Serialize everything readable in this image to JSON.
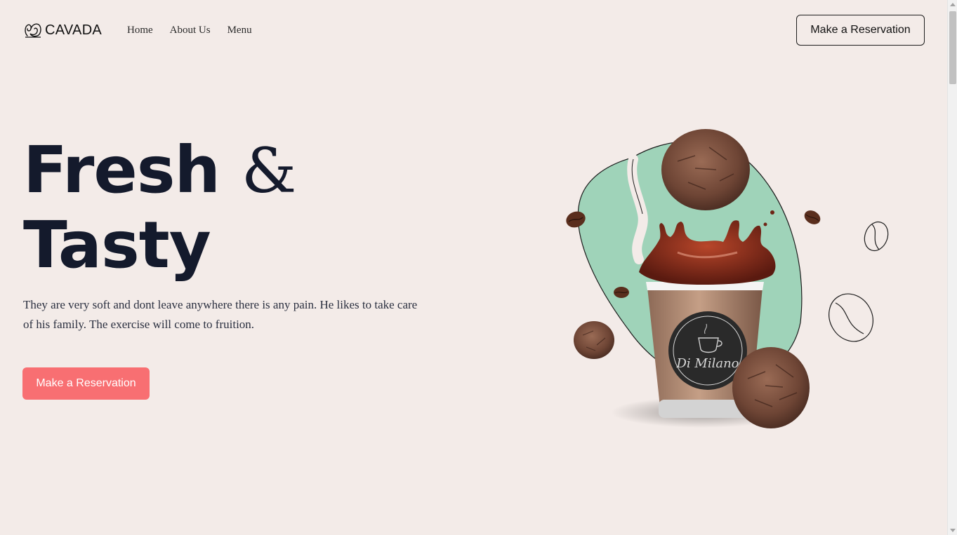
{
  "brand": {
    "name": "CAVADA"
  },
  "nav": {
    "links": [
      "Home",
      "About Us",
      "Menu"
    ],
    "cta_label": "Make a Reservation"
  },
  "hero": {
    "title_line1_word": "Fresh",
    "title_line1_amp": "&",
    "title_line2": "Tasty",
    "description": "They are very soft and dont leave anywhere there is any pain. He likes to take care of his family. The exercise will come to fruition.",
    "cta_label": "Make a Reservation",
    "cup_label": "Di Milano"
  },
  "colors": {
    "background": "#f3ebe8",
    "accent": "#f86f72",
    "blob": "#9fd3b9",
    "heading": "#141a2c"
  },
  "icons": [
    "brand-logo-icon",
    "coffee-bean-icon",
    "cookie-image",
    "coffee-cup-image"
  ]
}
